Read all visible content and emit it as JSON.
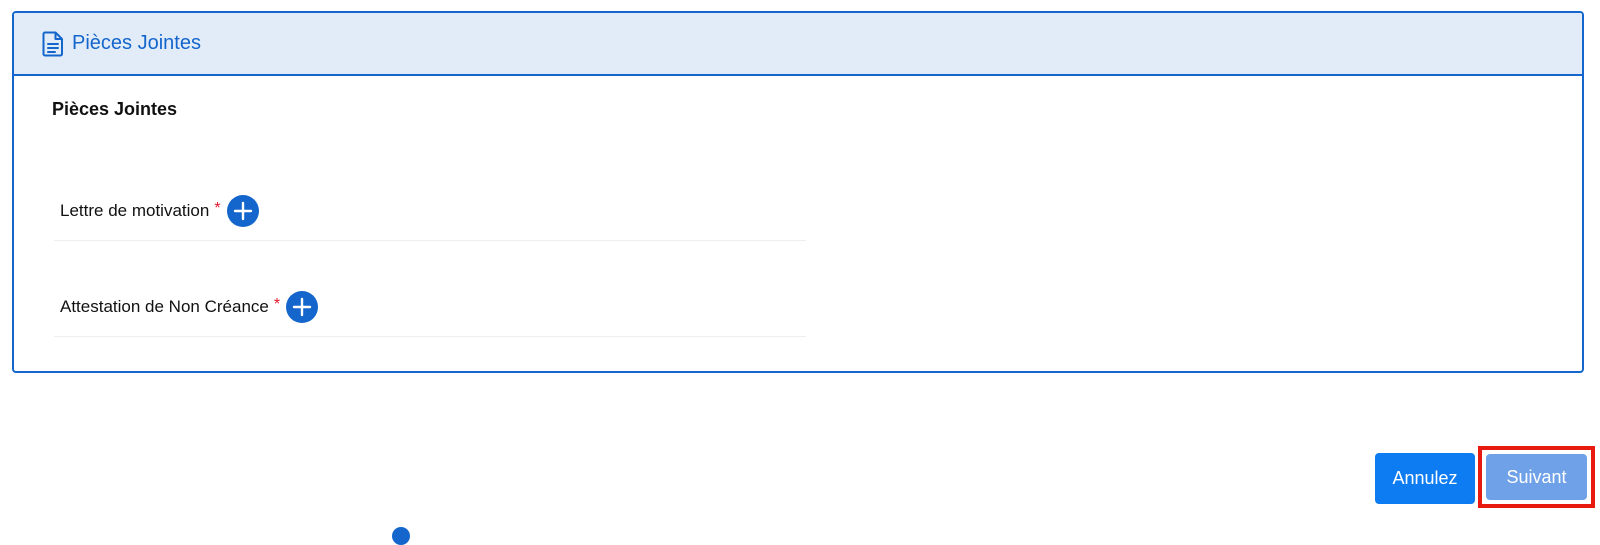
{
  "panel": {
    "title": "Pièces Jointes",
    "icon": "document-icon"
  },
  "section": {
    "title": "Pièces Jointes"
  },
  "fields": [
    {
      "label": "Lettre de motivation",
      "required": "*",
      "icon": "plus-circle-icon"
    },
    {
      "label": "Attestation de Non Créance",
      "required": "*",
      "icon": "plus-circle-icon"
    }
  ],
  "actions": {
    "cancel_label": "Annulez",
    "next_label": "Suivant"
  },
  "colors": {
    "accent": "#1466cc",
    "header_bg": "#e1ecf8",
    "required": "#e0182d",
    "cancel_bg": "#0d7cf2",
    "next_bg_disabled": "#6fa1e8",
    "highlight": "#e8190f"
  }
}
